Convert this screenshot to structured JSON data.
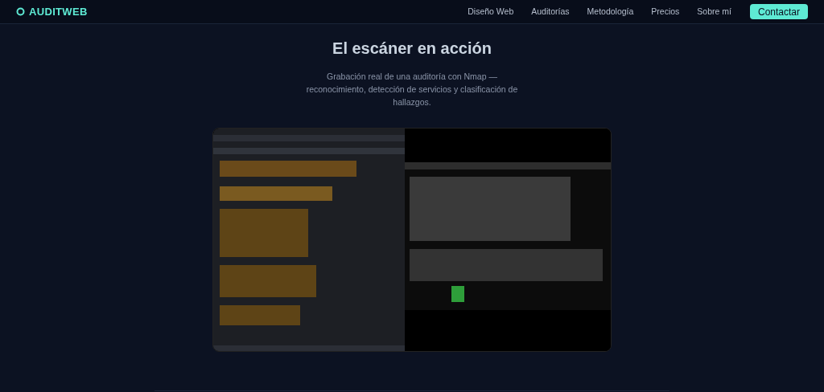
{
  "header": {
    "logo": "AUDITWEB",
    "nav": [
      {
        "label": "Diseño Web"
      },
      {
        "label": "Auditorías"
      },
      {
        "label": "Metodología"
      },
      {
        "label": "Precios"
      },
      {
        "label": "Sobre mí"
      }
    ],
    "cta": "Contactar"
  },
  "section": {
    "title": "El escáner en acción",
    "subtitle": "Grabación real de una auditoría con Nmap — reconocimiento, detección de servicios y clasificación de hallazgos."
  }
}
